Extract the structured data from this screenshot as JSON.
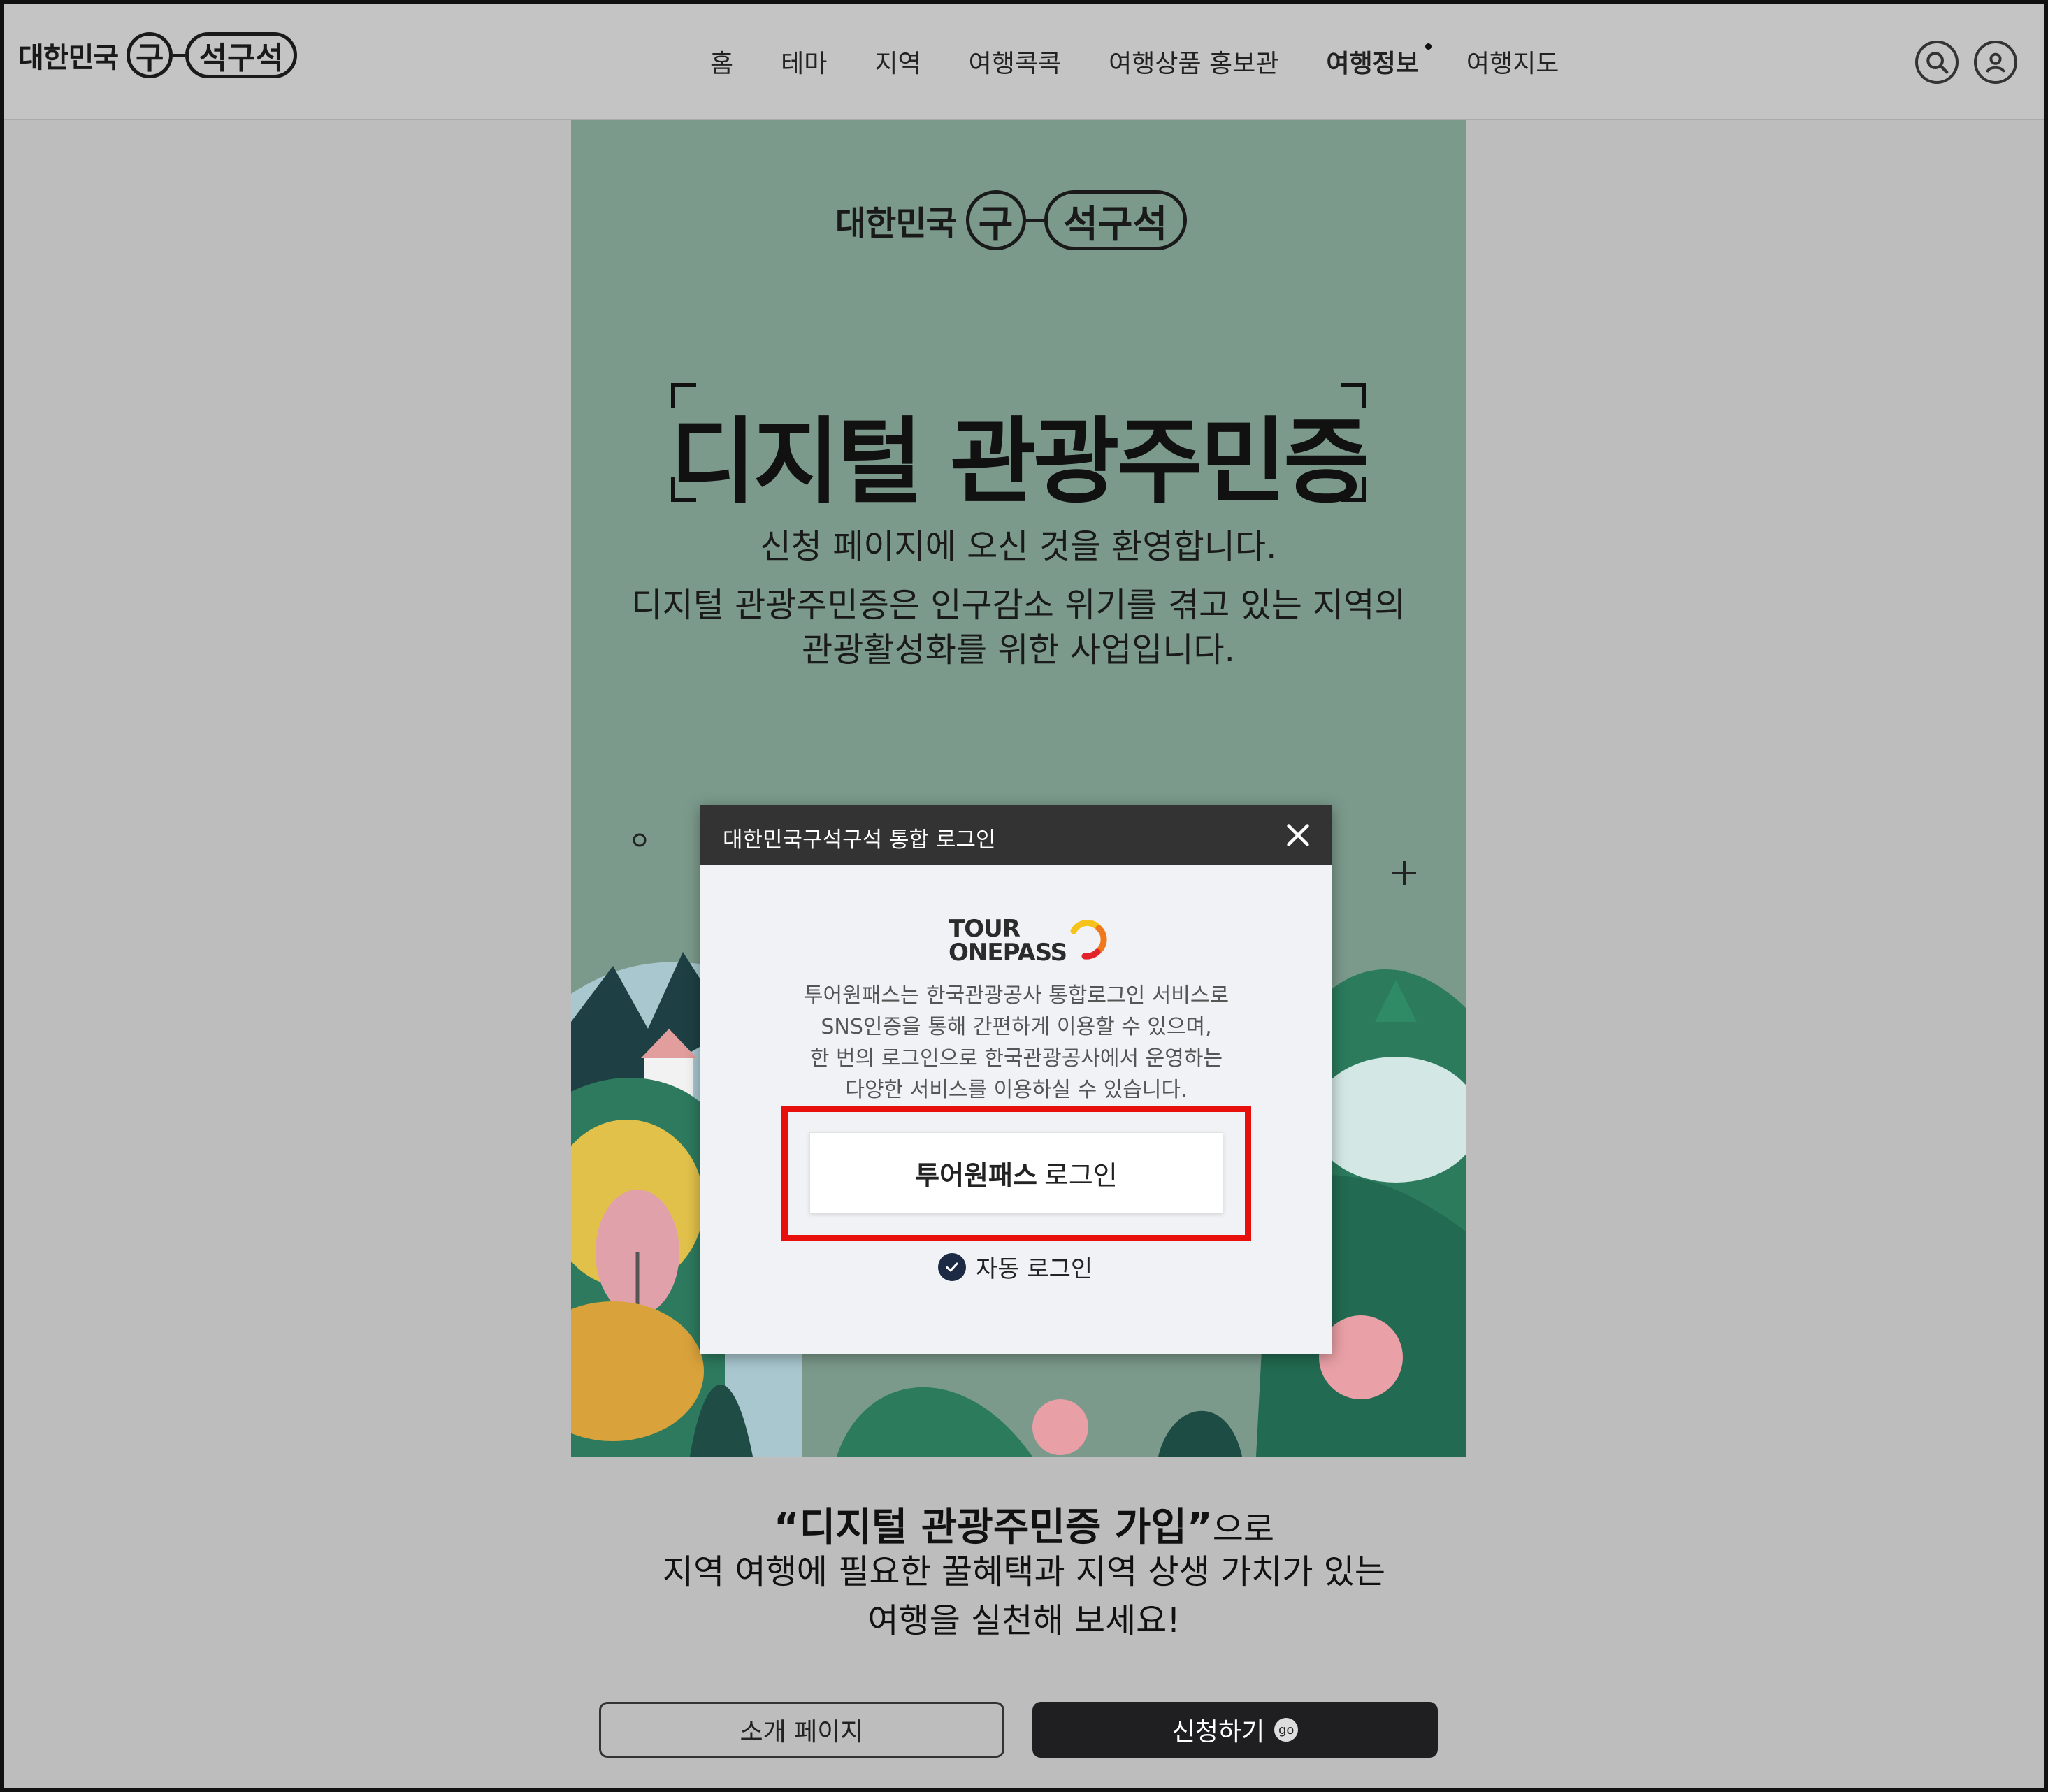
{
  "brand": {
    "prefix": "대한민국",
    "circle": "구",
    "pill": "석구석"
  },
  "nav": {
    "items": [
      "홈",
      "테마",
      "지역",
      "여행콕콕",
      "여행상품 홍보관",
      "여행정보",
      "여행지도"
    ],
    "active": "여행정보"
  },
  "icons": {
    "search": "search-icon",
    "user": "user-icon"
  },
  "hero": {
    "title": "디지털 관광주민증",
    "sub1": "신청 페이지에 오신 것을 환영합니다.",
    "sub2_line1": "디지털 관광주민증은 인구감소 위기를 겪고 있는 지역의",
    "sub2_line2": "관광활성화를 위한 사업입니다."
  },
  "modal": {
    "title": "대한민국구석구석 통합 로그인",
    "logo_line1": "TOUR",
    "logo_line2": "ONEPASS",
    "desc_line1": "투어원패스는 한국관광공사 통합로그인 서비스로",
    "desc_line2": "SNS인증을 통해 간편하게 이용할 수 있으며,",
    "desc_line3": "한 번의 로그인으로 한국관광공사에서 운영하는",
    "desc_line4": "다양한 서비스를 이용하실 수 있습니다.",
    "login_bold": "투어원패스",
    "login_rest": "로그인",
    "auto_login": "자동 로그인"
  },
  "bottom": {
    "quote": "“디지털 관광주민증 가입”",
    "quote_suffix": "으로",
    "line2": "지역 여행에 필요한 꿀혜택과 지역 상생 가치가 있는",
    "line3": "여행을 실천해 보세요!",
    "intro_button": "소개 페이지",
    "apply_button": "신청하기",
    "go_badge": "go"
  },
  "colors": {
    "hero_bg": "#7b9a8b",
    "highlight": "#e8100c",
    "apply_bg": "#1f1f21"
  }
}
